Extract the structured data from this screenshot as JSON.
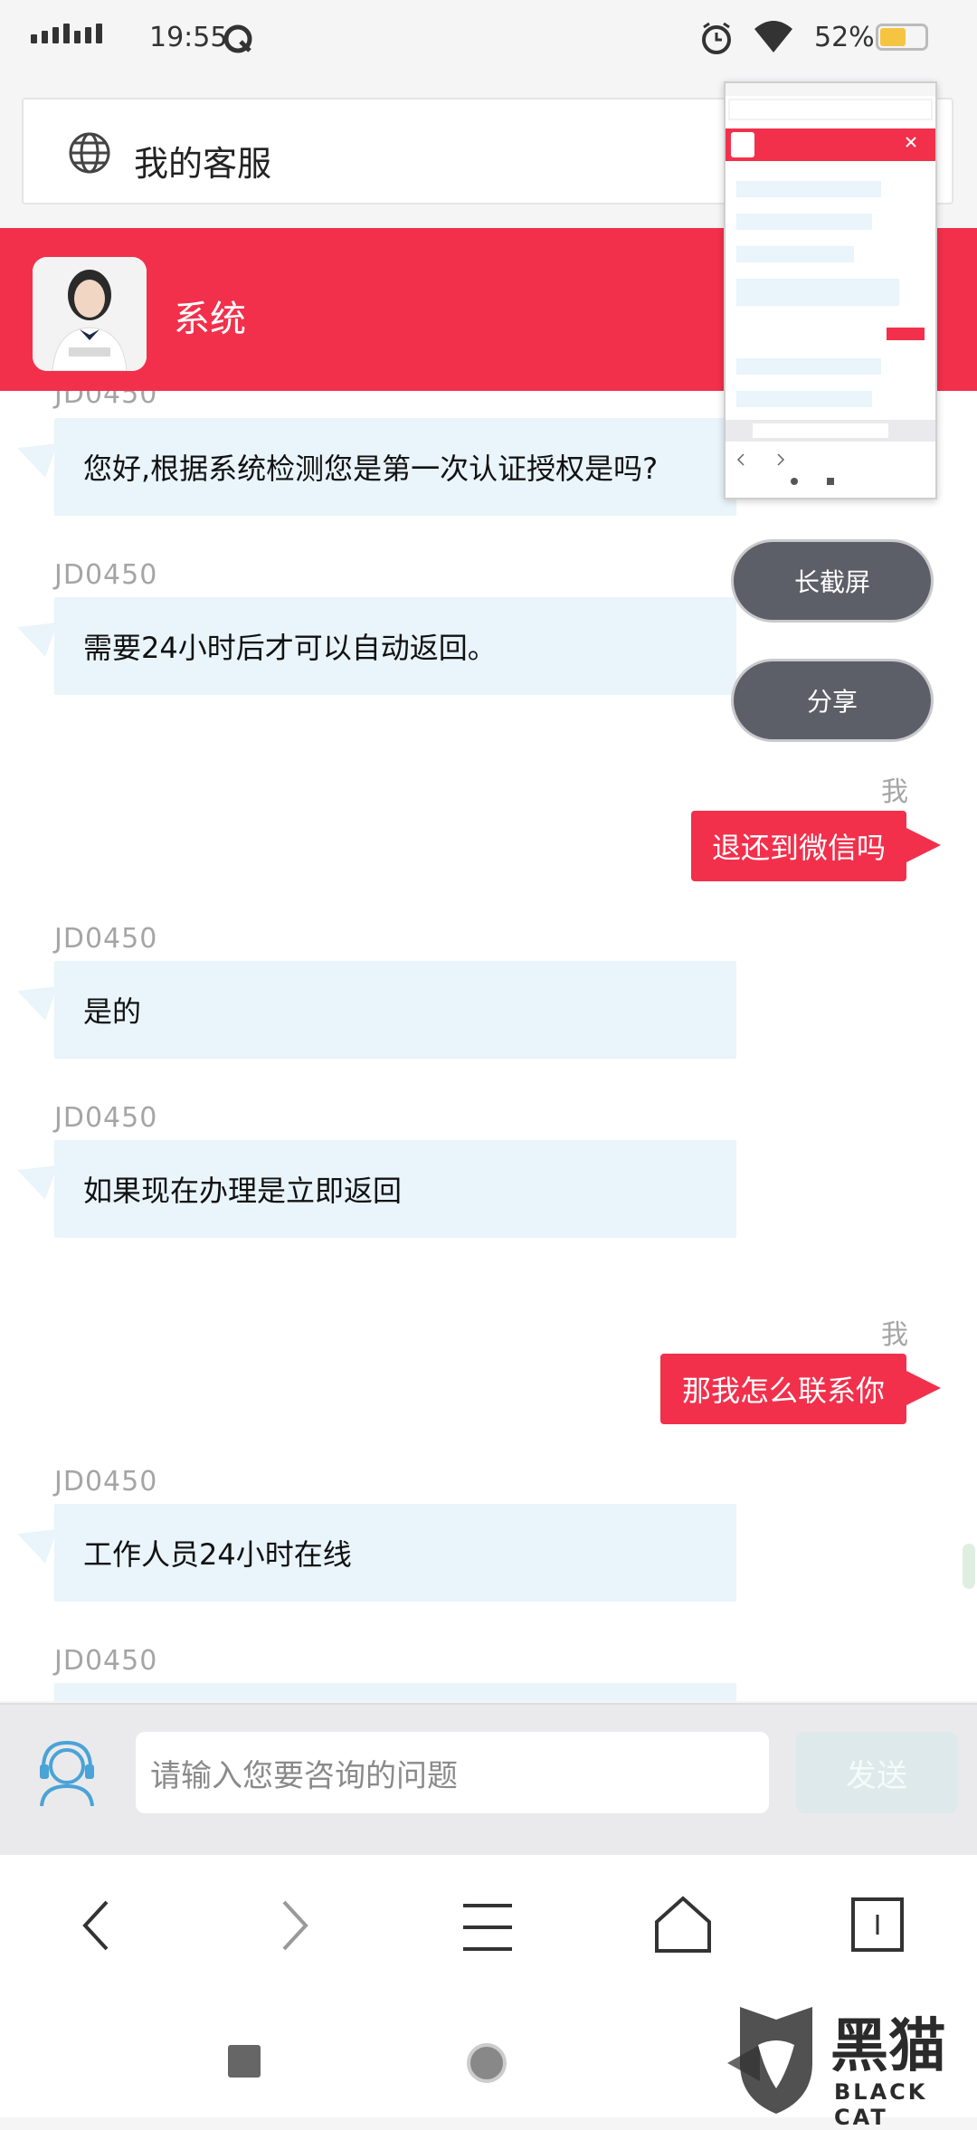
{
  "status_bar": {
    "time": "19:55",
    "battery_percent": "52%"
  },
  "address_bar": {
    "title": "我的客服"
  },
  "header": {
    "title": "系统"
  },
  "floating_actions": {
    "long_screenshot": "长截屏",
    "share": "分享"
  },
  "messages": [
    {
      "from": "JD0450",
      "text": "您好,根据系统检测您是第一次认证授权是吗?"
    },
    {
      "from": "JD0450",
      "text": "需要24小时后才可以自动返回。"
    },
    {
      "from": "我",
      "text": "退还到微信吗"
    },
    {
      "from": "JD0450",
      "text": "是的"
    },
    {
      "from": "JD0450",
      "text": "如果现在办理是立即返回"
    },
    {
      "from": "我",
      "text": "那我怎么联系你"
    },
    {
      "from": "JD0450",
      "text": "工作人员24小时在线"
    },
    {
      "from": "JD0450",
      "text": ""
    }
  ],
  "input": {
    "placeholder": "请输入您要咨询的问题",
    "send_label": "发送"
  },
  "watermark": {
    "text": "黑猫",
    "subtext": "BLACK CAT"
  },
  "colors": {
    "accent": "#f2304b",
    "bubble_in": "#e9f4fb",
    "float_button": "#5d5f68"
  }
}
